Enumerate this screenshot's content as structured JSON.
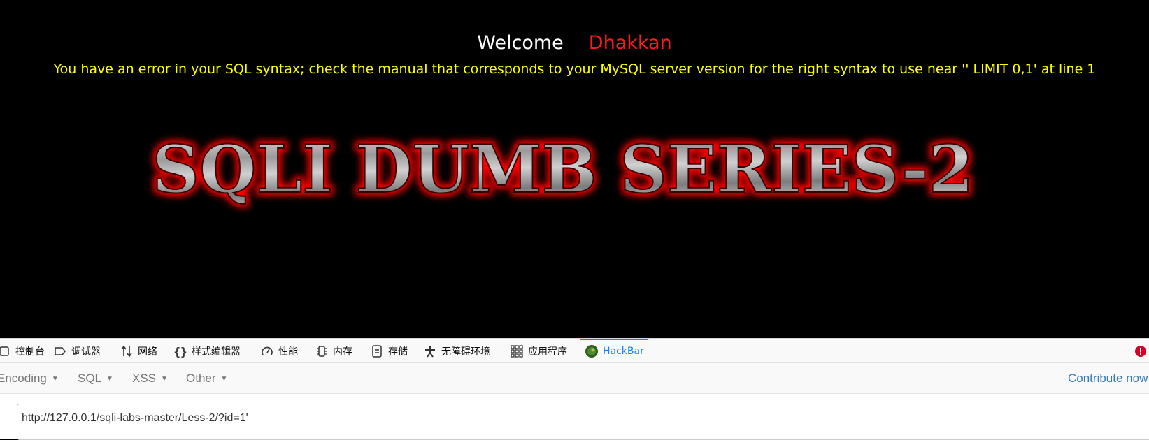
{
  "page": {
    "welcome_label": "Welcome",
    "user_name": "Dhakkan",
    "error_message": "You have an error in your SQL syntax; check the manual that corresponds to your MySQL server version for the right syntax to use near '' LIMIT 0,1' at line 1",
    "logo_text": "SQLI DUMB SERIES-2"
  },
  "devtools": {
    "tabs": [
      {
        "label": "控制台",
        "icon": "console-icon"
      },
      {
        "label": "调试器",
        "icon": "debugger-icon"
      },
      {
        "label": "网络",
        "icon": "network-icon"
      },
      {
        "label": "样式编辑器",
        "icon": "style-editor-icon"
      },
      {
        "label": "性能",
        "icon": "performance-icon"
      },
      {
        "label": "内存",
        "icon": "memory-icon"
      },
      {
        "label": "存储",
        "icon": "storage-icon"
      },
      {
        "label": "无障碍环境",
        "icon": "accessibility-icon"
      },
      {
        "label": "应用程序",
        "icon": "application-icon"
      },
      {
        "label": "HackBar",
        "icon": "hackbar-icon",
        "active": true
      }
    ],
    "error_indicator": "alert-icon"
  },
  "hackbar": {
    "menus": [
      "Encoding",
      "SQL",
      "XSS",
      "Other"
    ],
    "contribute_label": "Contribute now",
    "url_value": "http://127.0.0.1/sqli-labs-master/Less-2/?id=1'"
  },
  "colors": {
    "background": "#000000",
    "welcome": "#ffffff",
    "user_name": "#ff1a1a",
    "error_text": "#ffff00",
    "active_tab": "#0a84ff",
    "link": "#337ab7"
  }
}
